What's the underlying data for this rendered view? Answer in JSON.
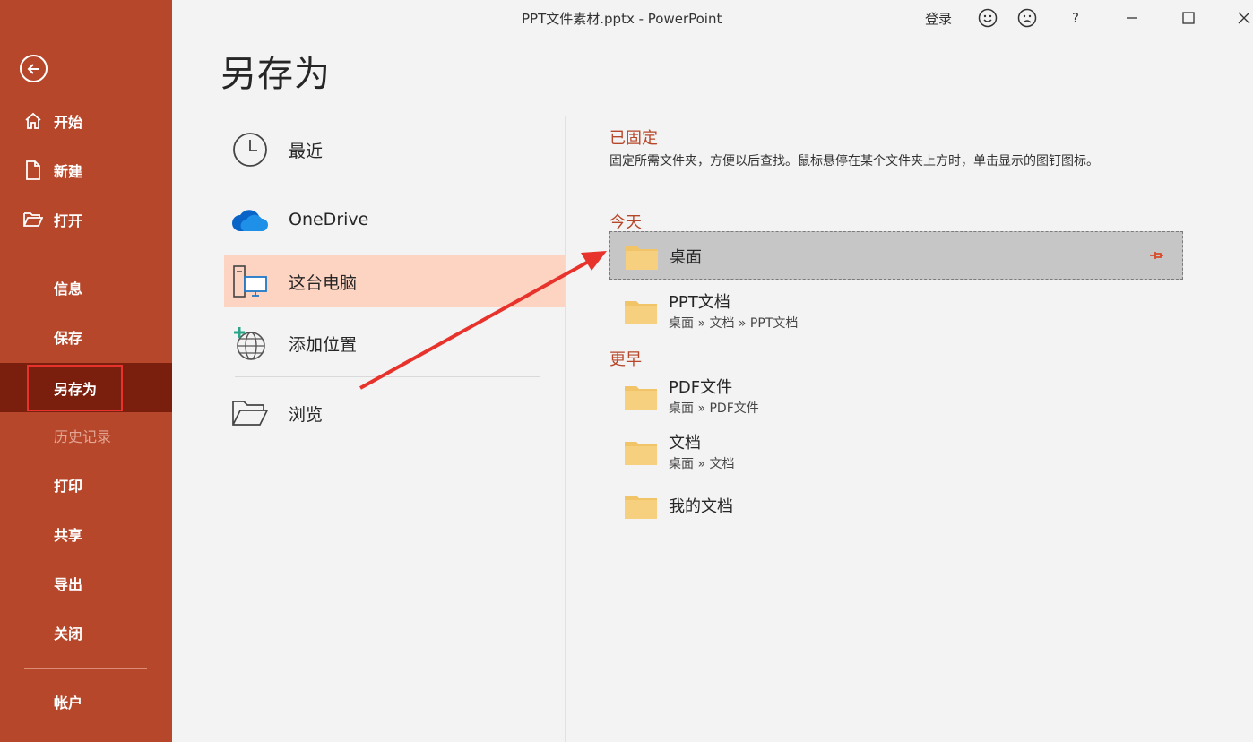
{
  "window": {
    "title": "PPT文件素材.pptx  -  PowerPoint",
    "login": "登录",
    "help": "?"
  },
  "sidebar": {
    "items": [
      {
        "label": "开始"
      },
      {
        "label": "新建"
      },
      {
        "label": "打开"
      },
      {
        "label": "信息"
      },
      {
        "label": "保存"
      },
      {
        "label": "另存为"
      },
      {
        "label": "历史记录"
      },
      {
        "label": "打印"
      },
      {
        "label": "共享"
      },
      {
        "label": "导出"
      },
      {
        "label": "关闭"
      },
      {
        "label": "帐户"
      }
    ]
  },
  "page": {
    "title": "另存为"
  },
  "locations": [
    {
      "label": "最近"
    },
    {
      "label": "OneDrive"
    },
    {
      "label": "这台电脑"
    },
    {
      "label": "添加位置"
    },
    {
      "label": "浏览"
    }
  ],
  "pinned": {
    "heading": "已固定",
    "description": "固定所需文件夹，方便以后查找。鼠标悬停在某个文件夹上方时，单击显示的图钉图标。"
  },
  "today": {
    "heading": "今天",
    "folders": [
      {
        "name": "桌面",
        "path": ""
      },
      {
        "name": "PPT文档",
        "path": "桌面 » 文档 » PPT文档"
      }
    ]
  },
  "earlier": {
    "heading": "更早",
    "folders": [
      {
        "name": "PDF文件",
        "path": "桌面 » PDF文件"
      },
      {
        "name": "文档",
        "path": "桌面 » 文档"
      },
      {
        "name": "我的文档",
        "path": ""
      }
    ]
  },
  "colors": {
    "sidebar": "#b7472a",
    "sidebar_active": "#7a1e0d",
    "accent": "#b7472a",
    "highlight": "#fdd3c1",
    "folder": "#f2c468",
    "arrow": "#e8322c"
  }
}
